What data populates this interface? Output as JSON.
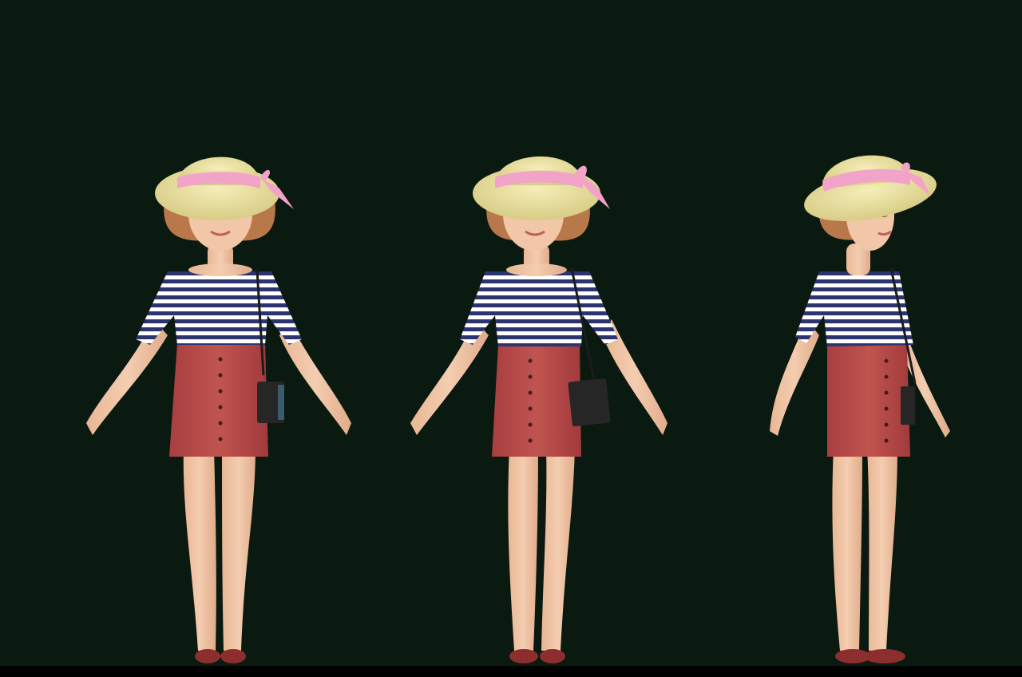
{
  "scene": {
    "background_color": "#0b1a10",
    "bottom_bar_color": "#000000",
    "views": [
      {
        "id": "view-front",
        "pose": "front"
      },
      {
        "id": "view-three-quarter",
        "pose": "three-quarter"
      },
      {
        "id": "view-side",
        "pose": "side"
      }
    ]
  },
  "character": {
    "hat_color": "#ece3a0",
    "hat_band_color": "#f2a3c8",
    "hair_color": "#b9784a",
    "skin_color": "#f1c7a8",
    "shirt_stripe_colors": [
      "#2c3470",
      "#ffffff"
    ],
    "skirt_color": "#b84a4a",
    "button_color": "#3a2020",
    "bag_color": "#262626",
    "shoe_color": "#8c2e2e"
  }
}
